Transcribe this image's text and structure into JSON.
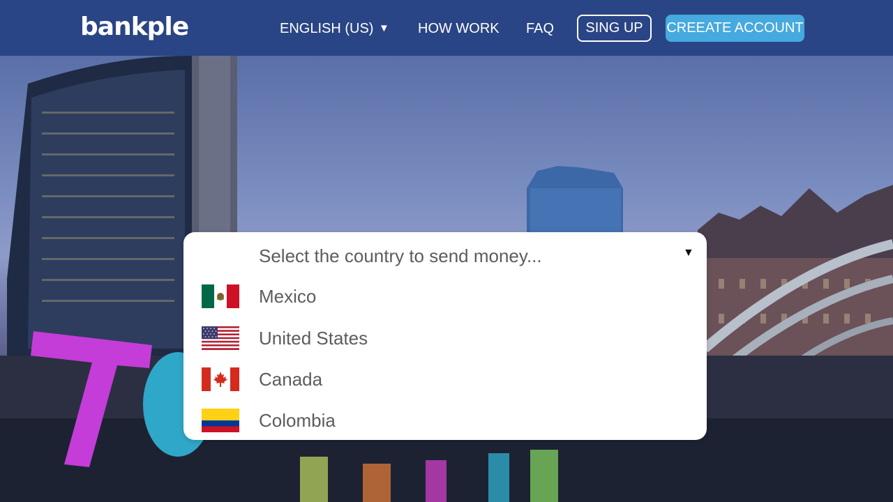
{
  "header": {
    "logo_text": "bankple",
    "language_label": "ENGLISH (US)",
    "language_caret": "▼",
    "how_work_label": "HOW WORK",
    "faq_label": "FAQ",
    "signup_label": "SING UP",
    "create_account_label": "CREEATE ACCOUNT"
  },
  "colors": {
    "header_bg": "#2a4585",
    "accent": "#46a9df",
    "card_bg": "#ffffff",
    "text_muted": "#5c5c5c"
  },
  "country_select": {
    "placeholder": "Select the country to send money...",
    "caret": "▼",
    "options": [
      {
        "label": "Mexico",
        "icon": "mexico-flag-icon"
      },
      {
        "label": "United States",
        "icon": "usa-flag-icon"
      },
      {
        "label": "Canada",
        "icon": "canada-flag-icon"
      },
      {
        "label": "Colombia",
        "icon": "colombia-flag-icon"
      }
    ]
  }
}
